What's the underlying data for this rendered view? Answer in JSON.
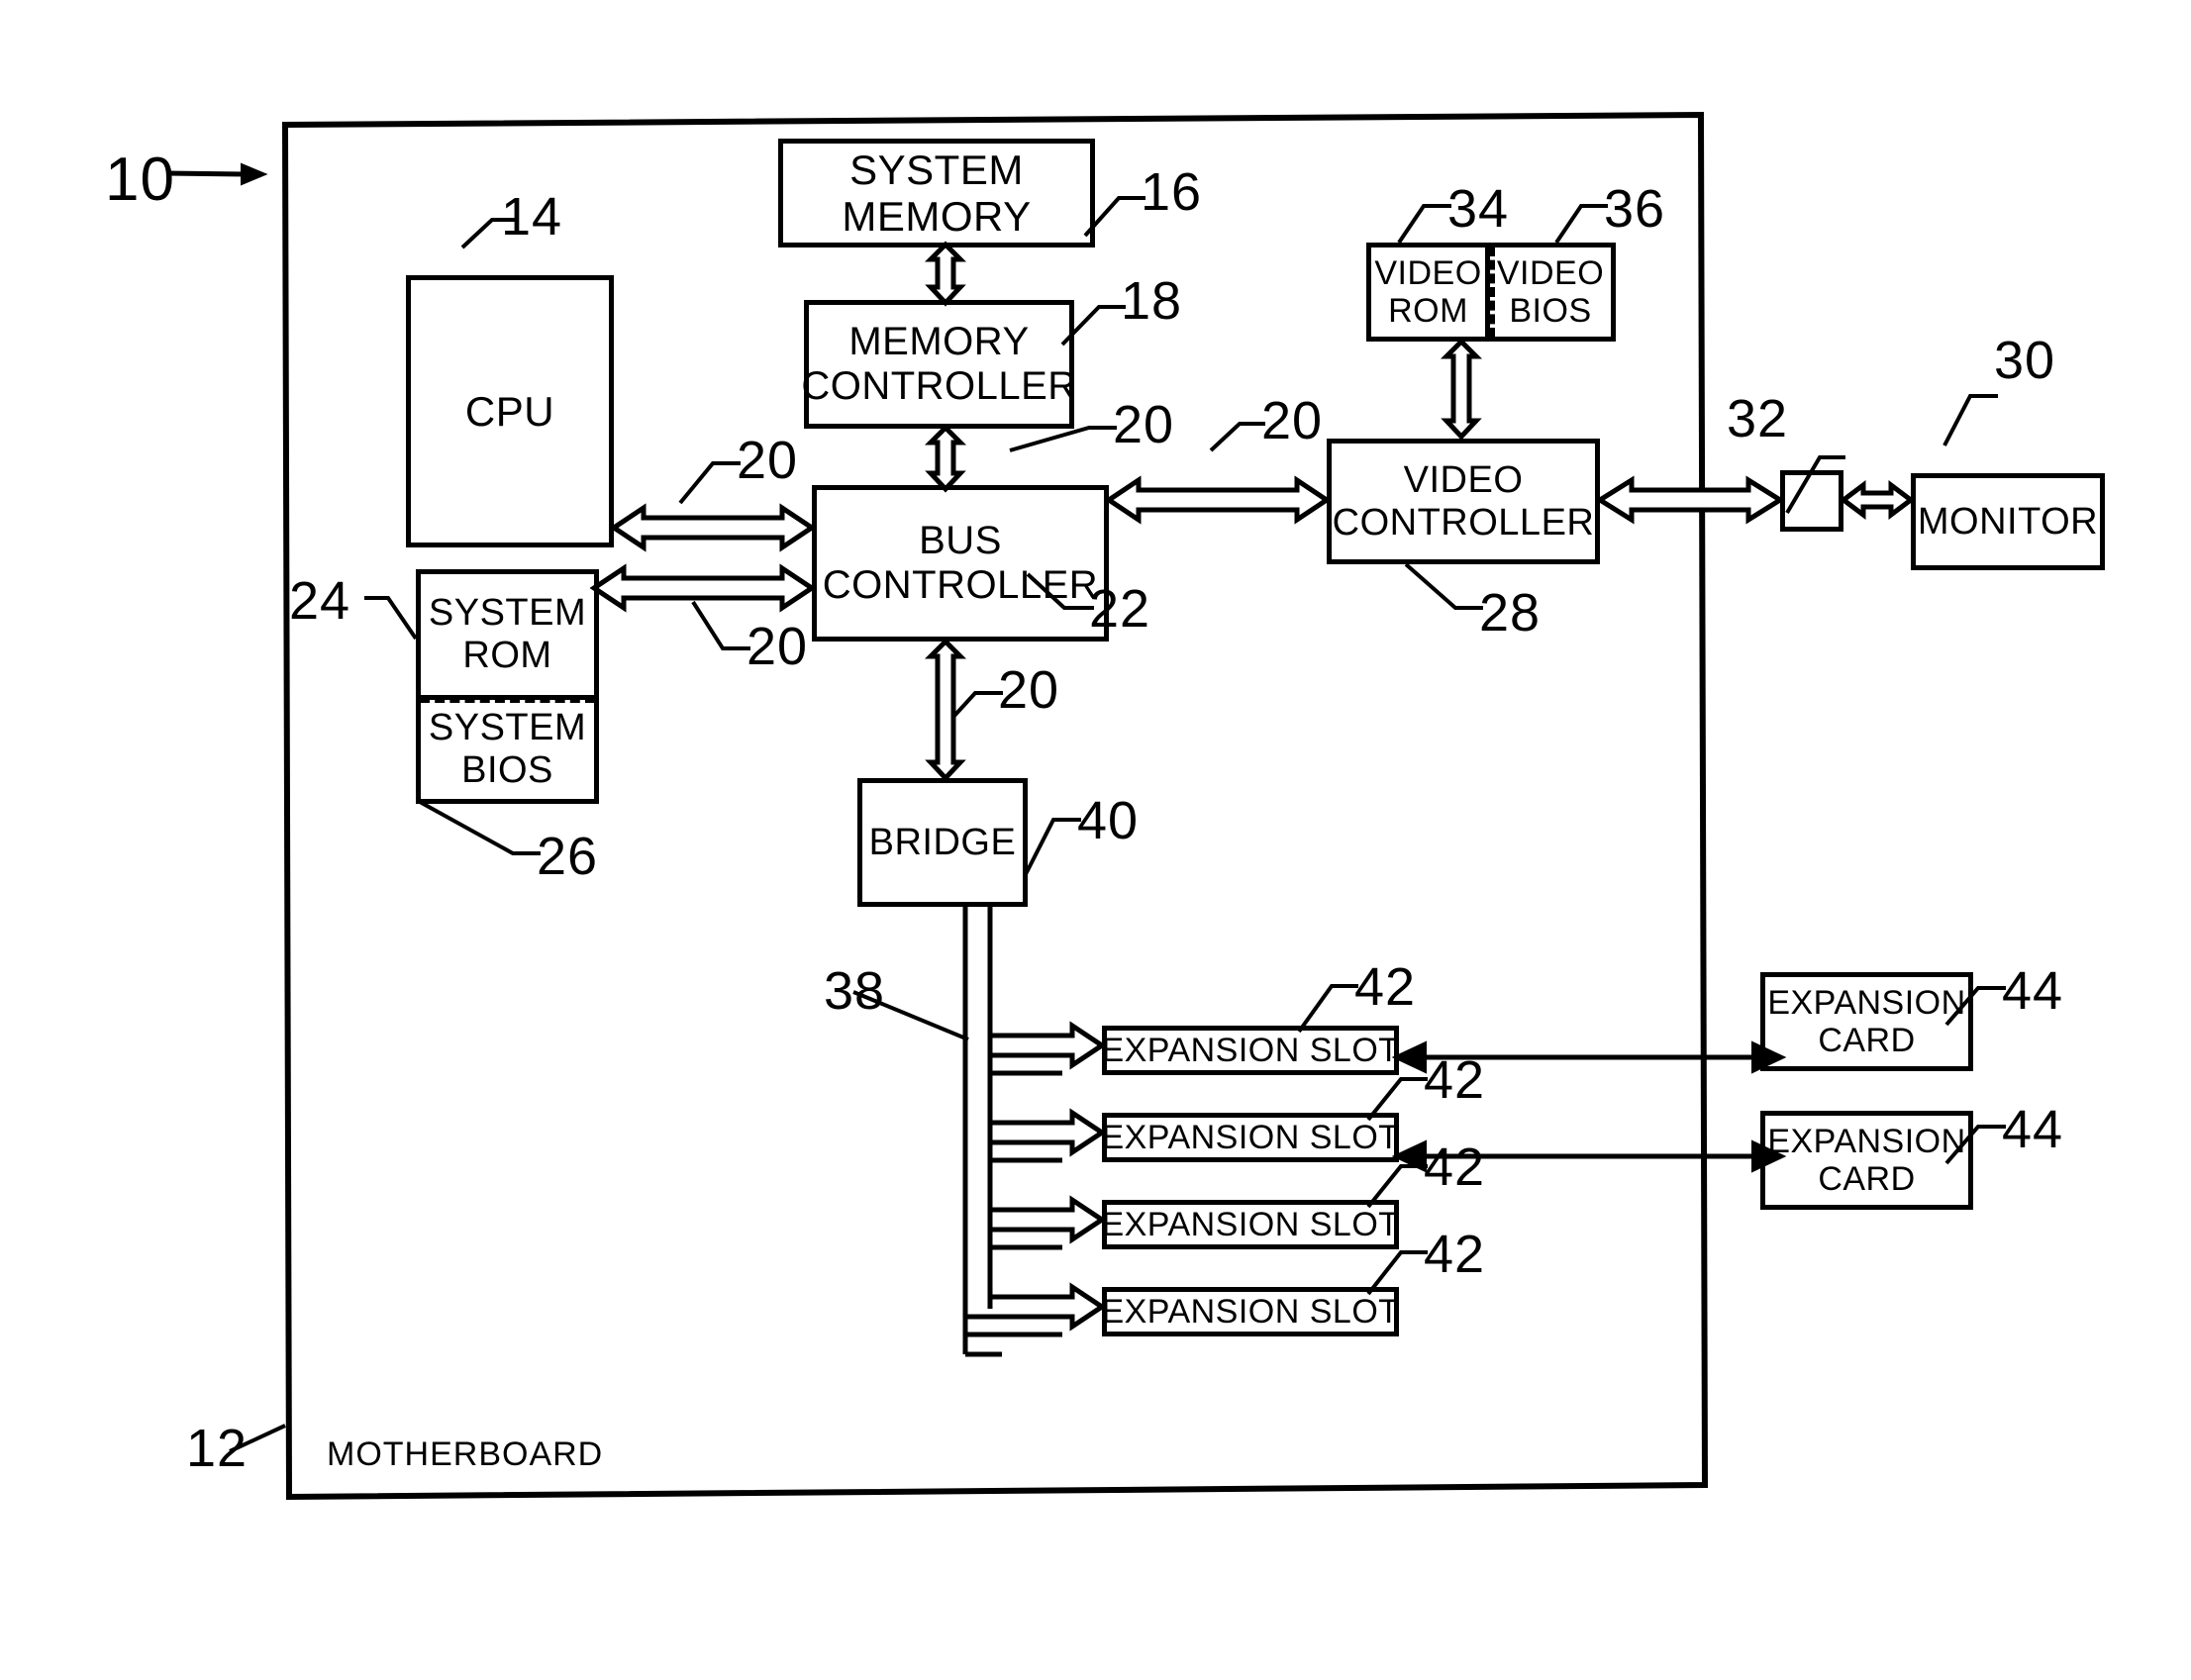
{
  "figure": {
    "title_label": "MOTHERBOARD",
    "system_ref": "10",
    "motherboard_ref": "12"
  },
  "blocks": {
    "cpu": {
      "label": "CPU",
      "ref": "14"
    },
    "system_memory": {
      "line1": "SYSTEM",
      "line2": "MEMORY",
      "ref": "16"
    },
    "memory_controller": {
      "line1": "MEMORY",
      "line2": "CONTROLLER",
      "ref": "18"
    },
    "bus_controller": {
      "line1": "BUS",
      "line2": "CONTROLLER",
      "ref": "22"
    },
    "system_rom": {
      "line1": "SYSTEM",
      "line2": "ROM",
      "ref": "24"
    },
    "system_bios": {
      "line1": "SYSTEM",
      "line2": "BIOS",
      "ref": "26"
    },
    "video_controller": {
      "line1": "VIDEO",
      "line2": "CONTROLLER",
      "ref": "28"
    },
    "video_rom": {
      "line1": "VIDEO",
      "line2": "ROM",
      "ref": "34"
    },
    "video_bios": {
      "line1": "VIDEO",
      "line2": "BIOS",
      "ref": "36"
    },
    "monitor": {
      "label": "MONITOR",
      "ref": "30"
    },
    "connector": {
      "label": "",
      "ref": "32"
    },
    "bridge": {
      "label": "BRIDGE",
      "ref": "40"
    }
  },
  "buses": {
    "system_bus_ref": "20",
    "expansion_bus_ref": "38"
  },
  "expansion_slots": [
    {
      "label": "EXPANSION SLOT",
      "ref": "42"
    },
    {
      "label": "EXPANSION SLOT",
      "ref": "42"
    },
    {
      "label": "EXPANSION SLOT",
      "ref": "42"
    },
    {
      "label": "EXPANSION SLOT",
      "ref": "42"
    }
  ],
  "expansion_cards": [
    {
      "line1": "EXPANSION",
      "line2": "CARD",
      "ref": "44"
    },
    {
      "line1": "EXPANSION",
      "line2": "CARD",
      "ref": "44"
    }
  ],
  "bus_ref_labels": [
    "20",
    "20",
    "20",
    "20",
    "20"
  ],
  "colors": {
    "stroke": "#000000",
    "background": "#ffffff"
  }
}
